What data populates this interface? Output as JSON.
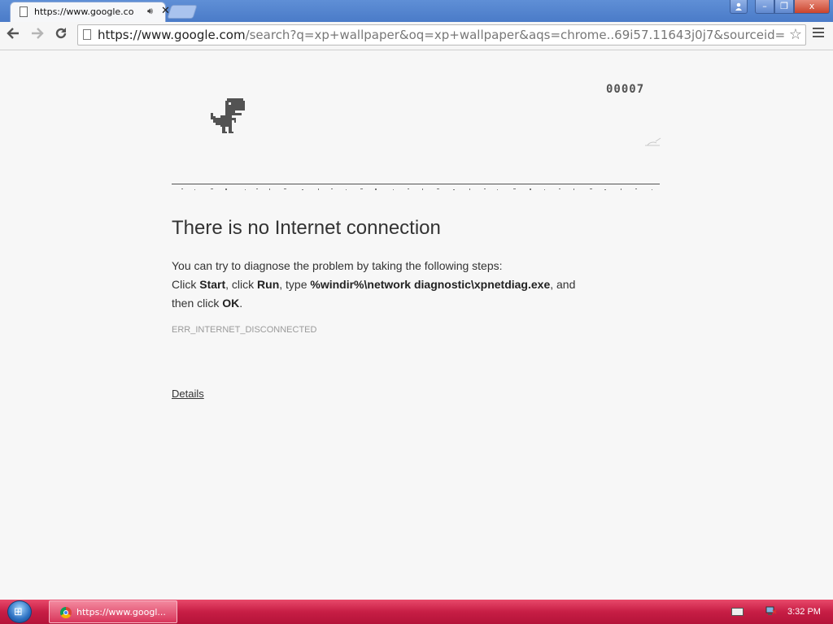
{
  "browser": {
    "tab": {
      "title": "https://www.google.co",
      "audio_icon": "speaker-icon",
      "close_label": "✕"
    },
    "window_controls": {
      "minimize": "–",
      "maximize": "❐",
      "close": "x"
    },
    "address": {
      "host": "https://www.google.com",
      "path": "/search?q=xp+wallpaper&oq=xp+wallpaper&aqs=chrome..69i57.11643j0j7&sourceid=chrome&"
    }
  },
  "game": {
    "score": "00007"
  },
  "error": {
    "headline": "There is no Internet connection",
    "line1": "You can try to diagnose the problem by taking the following steps:",
    "click1": "Click ",
    "start": "Start",
    "click2": ", click ",
    "run": "Run",
    "type": ", type ",
    "command": "%windir%\\network diagnostic\\xpnetdiag.exe",
    "and": ", and",
    "then": "then click ",
    "ok": "OK",
    "period": ".",
    "code": "ERR_INTERNET_DISCONNECTED",
    "details": "Details"
  },
  "taskbar": {
    "item_label": "https://www.googl...",
    "clock": "3:32 PM"
  },
  "colors": {
    "dino": "#535353",
    "taskbar": "#c71e45",
    "titlebar": "#4a7bc8"
  }
}
